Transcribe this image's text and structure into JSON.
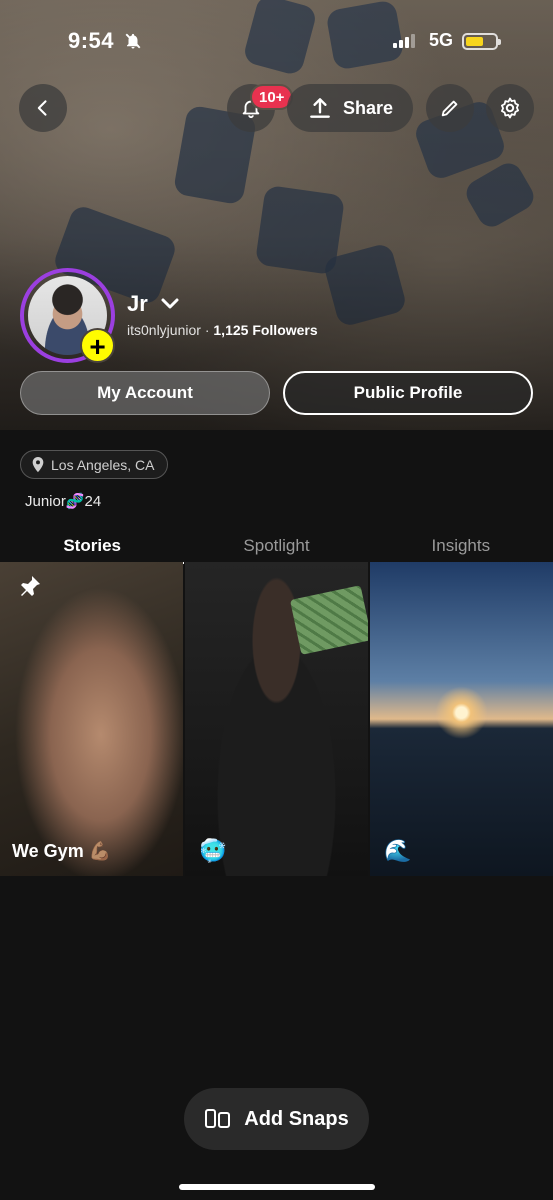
{
  "status_bar": {
    "time": "9:54",
    "network": "5G",
    "battery_level": 0.6
  },
  "header": {
    "notification_badge": "10+",
    "share_label": "Share"
  },
  "profile": {
    "display_name": "Jr",
    "username": "its0nlyjunior",
    "separator": "·",
    "followers": "1,125 Followers",
    "my_account_label": "My Account",
    "public_profile_label": "Public Profile",
    "location": "Los Angeles, CA",
    "bio": "Junior🧬24"
  },
  "tabs": [
    {
      "label": "Stories",
      "active": true
    },
    {
      "label": "Spotlight",
      "active": false
    },
    {
      "label": "Insights",
      "active": false
    }
  ],
  "stories": [
    {
      "caption": "We Gym 💪🏽",
      "pinned": true
    },
    {
      "emoji": "🥶"
    },
    {
      "emoji": "🌊"
    }
  ],
  "footer": {
    "add_snaps_label": "Add Snaps"
  },
  "colors": {
    "accent_ring": "#9b3fe0",
    "add_badge": "#fffc00",
    "notification": "#e8324f",
    "battery": "#f7d51d"
  }
}
